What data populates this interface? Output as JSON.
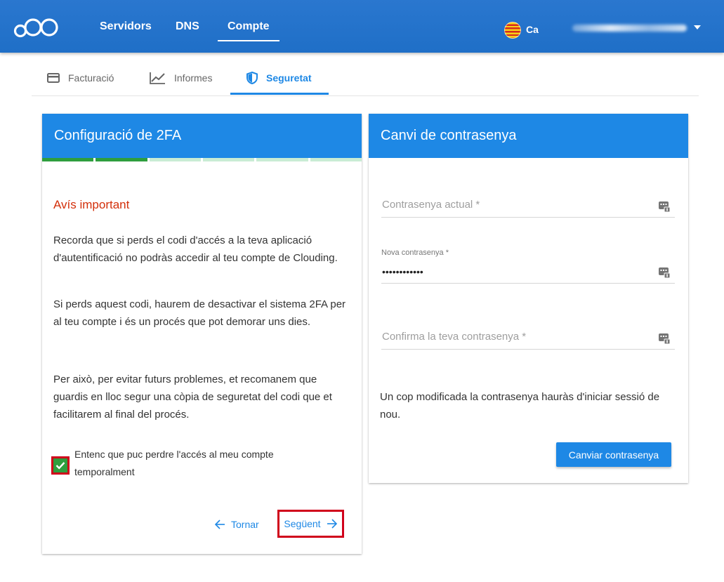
{
  "nav": {
    "items": [
      {
        "label": "Servidors"
      },
      {
        "label": "DNS"
      },
      {
        "label": "Compte"
      }
    ],
    "language": "Ca"
  },
  "subtabs": [
    {
      "label": "Facturació",
      "icon": "credit-card-icon"
    },
    {
      "label": "Informes",
      "icon": "chart-line-icon"
    },
    {
      "label": "Seguretat",
      "icon": "shield-icon"
    }
  ],
  "twofa": {
    "title": "Configuració de 2FA",
    "progress_done": 2,
    "progress_total": 6,
    "warning_title": "Avís important",
    "paragraph1": "Recorda que si perds el codi d'accés a la teva aplicació d'autentificació no podràs accedir al teu compte de Clouding.",
    "paragraph2": "Si perds aquest codi, haurem de desactivar el sistema 2FA per al teu compte i és un procés que pot demorar uns dies.",
    "paragraph3": "Per això, per evitar futurs problemes, et recomanem que guardis en lloc segur una còpia de seguretat del codi que et facilitarem al final del procés.",
    "checkbox_label": "Entenc que puc perdre l'accés al meu compte temporalment",
    "checkbox_checked": true,
    "back_label": "Tornar",
    "next_label": "Següent"
  },
  "password": {
    "title": "Canvi de contrasenya",
    "current_placeholder": "Contrasenya actual *",
    "new_label": "Nova contrasenya *",
    "new_value": "••••••••••••",
    "confirm_placeholder": "Confirma la teva contrasenya *",
    "info": "Un cop modificada la contrasenya hauràs d'iniciar sessió de nou.",
    "submit_label": "Canviar contrasenya"
  },
  "colors": {
    "primary": "#1e88e5",
    "warning": "#d32f0a",
    "success": "#2e9e3e",
    "highlight": "#d0021b"
  }
}
